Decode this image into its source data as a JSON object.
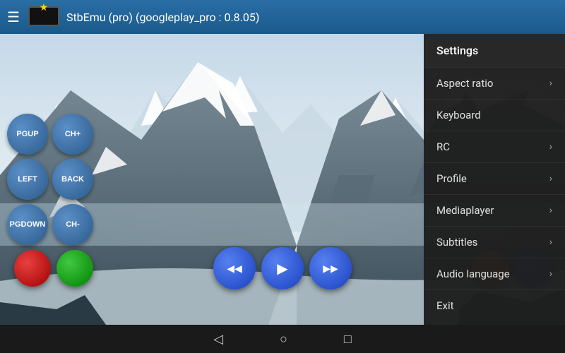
{
  "topbar": {
    "menu_icon": "☰",
    "star_icon": "★",
    "title": "StbEmu (pro) (googleplay_pro : 0.8.05)"
  },
  "controls": {
    "rows": [
      [
        {
          "label": "PGUP",
          "id": "pgup"
        },
        {
          "label": "CH+",
          "id": "chplus"
        }
      ],
      [
        {
          "label": "LEFT",
          "id": "left"
        },
        {
          "label": "BACK",
          "id": "back"
        }
      ],
      [
        {
          "label": "PGDOWN",
          "id": "pgdown"
        },
        {
          "label": "CH-",
          "id": "chminus"
        }
      ]
    ]
  },
  "transport": {
    "left_buttons": [
      {
        "id": "red",
        "color": "red",
        "label": ""
      },
      {
        "id": "green",
        "color": "green",
        "label": ""
      }
    ],
    "center_buttons": [
      {
        "id": "rewind",
        "color": "blue-mid",
        "label": "◀◀"
      },
      {
        "id": "play",
        "color": "blue-mid",
        "label": "▶"
      },
      {
        "id": "fast-forward",
        "color": "blue-mid",
        "label": "▶▶"
      }
    ],
    "right_buttons": [
      {
        "id": "orange",
        "color": "orange",
        "label": ""
      },
      {
        "id": "blue",
        "color": "blue-light",
        "label": ""
      }
    ]
  },
  "dropdown": {
    "header": "Settings",
    "items": [
      {
        "label": "Aspect ratio",
        "has_arrow": true,
        "id": "aspect-ratio"
      },
      {
        "label": "Keyboard",
        "has_arrow": false,
        "id": "keyboard"
      },
      {
        "label": "RC",
        "has_arrow": true,
        "id": "rc"
      },
      {
        "label": "Profile",
        "has_arrow": true,
        "id": "profile"
      },
      {
        "label": "Mediaplayer",
        "has_arrow": true,
        "id": "mediaplayer"
      },
      {
        "label": "Subtitles",
        "has_arrow": true,
        "id": "subtitles"
      },
      {
        "label": "Audio language",
        "has_arrow": true,
        "id": "audio-language"
      },
      {
        "label": "Exit",
        "has_arrow": false,
        "id": "exit"
      }
    ]
  },
  "navbar": {
    "back_icon": "◁",
    "home_icon": "○",
    "recent_icon": "□"
  }
}
